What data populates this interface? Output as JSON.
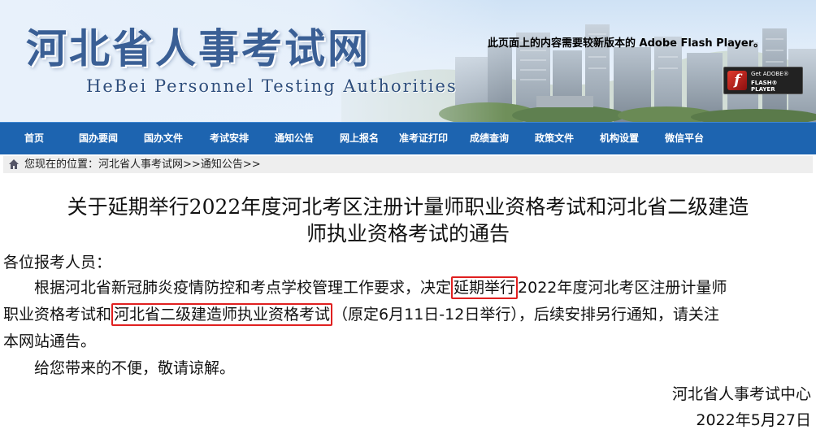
{
  "banner": {
    "title": "河北省人事考试网",
    "subtitle": "HeBei Personnel Testing Authorities",
    "flash_notice": "此页面上的内容需要较新版本的 Adobe Flash Player。",
    "flash_badge": {
      "get": "Get ADOBE®",
      "player": "FLASH® PLAYER",
      "logo": "f"
    }
  },
  "nav": {
    "items": [
      {
        "label": "首页"
      },
      {
        "label": "国办要闻"
      },
      {
        "label": "国办文件"
      },
      {
        "label": "考试安排"
      },
      {
        "label": "通知公告"
      },
      {
        "label": "网上报名"
      },
      {
        "label": "准考证打印"
      },
      {
        "label": "成绩查询"
      },
      {
        "label": "政策文件"
      },
      {
        "label": "机构设置"
      },
      {
        "label": "微信平台"
      }
    ]
  },
  "breadcrumb": {
    "prefix": "您现在的位置：",
    "items": [
      "河北省人事考试网",
      "通知公告"
    ],
    "separator": ">>",
    "home_icon": "home-icon"
  },
  "article": {
    "title_line1": "关于延期举行2022年度河北考区注册计量师职业资格考试和河北省二级建造",
    "title_line2": "师执业资格考试的通告",
    "salutation": "各位报考人员：",
    "para1": {
      "l1_a": "根据河北省新冠肺炎疫情防控和考点学校管理工作要求，决定",
      "l1_hl": "延期举行",
      "l1_b": "2022年度河北考区注册计量师",
      "l2_a": "职业资格考试和",
      "l2_hl": "河北省二级建造师执业资格考试",
      "l2_b": "（原定6月11日-12日举行），后续安排另行通知，请关注",
      "l3": "本网站通告。"
    },
    "para2": "给您带来的不便，敬请谅解。",
    "signature_org": "河北省人事考试中心",
    "signature_date": "2022年5月27日"
  },
  "colors": {
    "nav_bg": "#1d64b0",
    "title_blue": "#3a5f95",
    "highlight_border": "#e02020",
    "crumb_bg": "#eeeeee"
  }
}
